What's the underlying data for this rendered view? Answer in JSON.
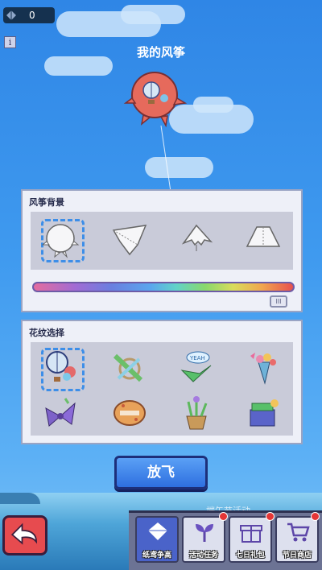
{
  "top_bar": {
    "coin_count": "0",
    "info_label": "i"
  },
  "page_title": "我的风筝",
  "background_panel": {
    "title": "风筝背景",
    "shapes": [
      "round-kite-shape",
      "diamond-kite-shape",
      "bat-kite-shape",
      "trapezoid-kite-shape"
    ],
    "selected_index": 0,
    "color_slider_value": 0.95
  },
  "pattern_panel": {
    "title": "花纹选择",
    "patterns": [
      "hot-air-balloon-pattern",
      "ship-wheel-pattern",
      "yeah-ribbon-pattern",
      "flower-bouquet-pattern",
      "purple-bow-pattern",
      "cookie-pattern",
      "flower-pot-pattern",
      "gift-box-pattern"
    ],
    "selected_index": 0
  },
  "fly_button_label": "放飞",
  "event_banner": "端午节活动",
  "bottom_nav": [
    {
      "label": "纸鸢争高",
      "icon": "kite-icon",
      "active": true,
      "badge": false
    },
    {
      "label": "活动任务",
      "icon": "sprout-icon",
      "active": false,
      "badge": true
    },
    {
      "label": "七日礼包",
      "icon": "gift-icon",
      "active": false,
      "badge": true
    },
    {
      "label": "节日商店",
      "icon": "cart-icon",
      "active": false,
      "badge": true
    }
  ],
  "colors": {
    "accent": "#3d8ee8",
    "kite": "#e66a5c",
    "panel": "#eef0f8",
    "badge": "#e53636"
  }
}
